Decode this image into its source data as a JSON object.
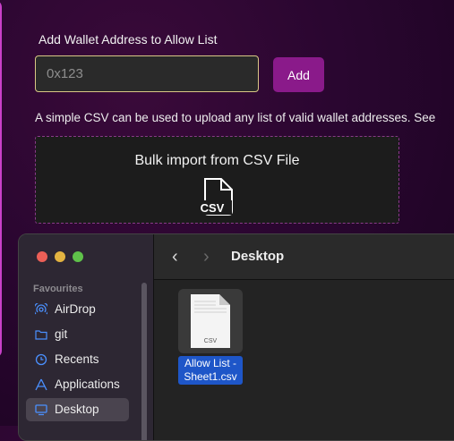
{
  "page": {
    "heading": "Add Wallet Address to Allow List",
    "input_placeholder": "0x123",
    "add_label": "Add",
    "description": "A simple CSV can be used to upload any list of valid wallet addresses. See",
    "dropzone": {
      "title": "Bulk import from CSV File",
      "icon_label": "CSV",
      "icon": "csv-file-icon"
    }
  },
  "finder": {
    "location": "Desktop",
    "sidebar": {
      "section": "Favourites",
      "items": [
        {
          "label": "AirDrop",
          "icon": "airdrop-icon"
        },
        {
          "label": "git",
          "icon": "folder-icon"
        },
        {
          "label": "Recents",
          "icon": "clock-icon"
        },
        {
          "label": "Applications",
          "icon": "applications-icon"
        },
        {
          "label": "Desktop",
          "icon": "desktop-icon",
          "selected": true
        }
      ]
    },
    "files": [
      {
        "name": "Allow List - Sheet1.csv",
        "thumb_label": "CSV",
        "selected": true
      }
    ]
  },
  "colors": {
    "accent": "#8a1a8a",
    "selection": "#1e56c8"
  }
}
